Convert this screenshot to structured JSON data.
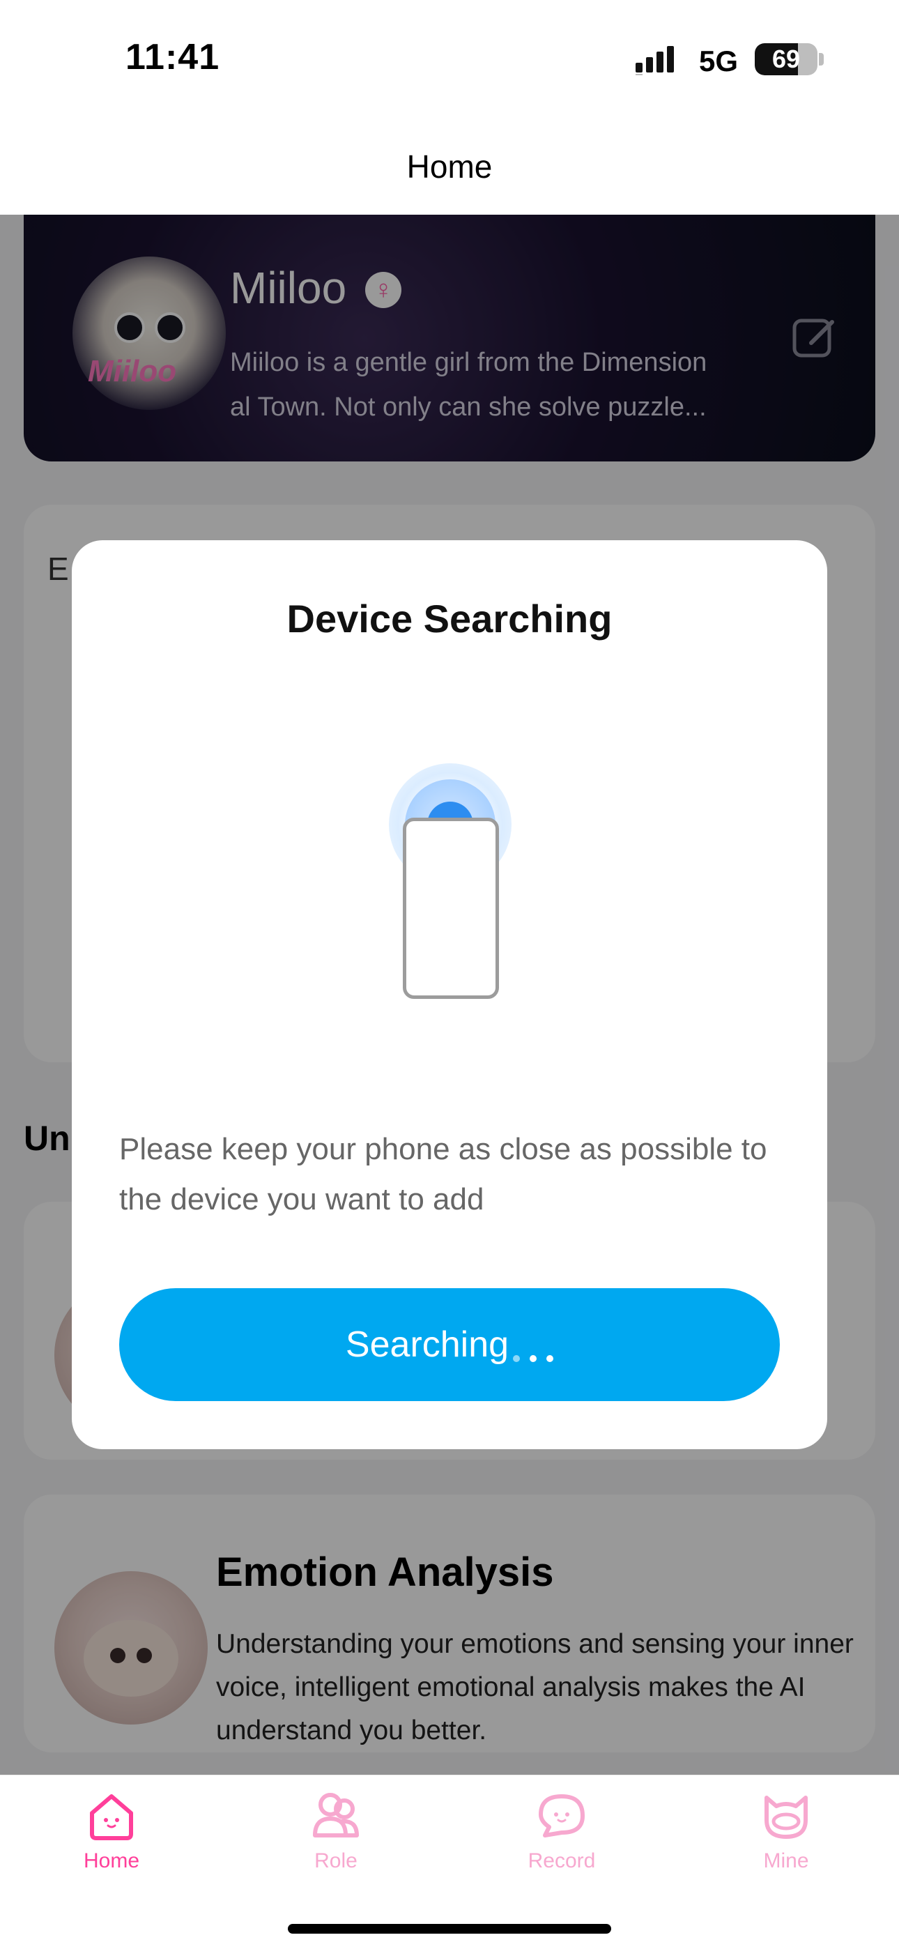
{
  "status_bar": {
    "time": "11:41",
    "network": "5G",
    "battery": "69",
    "battery_fraction": 0.69
  },
  "nav": {
    "title": "Home"
  },
  "role_card": {
    "name": "Miiloo",
    "logo_text": "Miiloo",
    "description_line1": "Miiloo is a gentle girl from the Dimension",
    "description_line2": "al Town. Not only can she solve puzzle..."
  },
  "device_card": {
    "title_peek": "E"
  },
  "section": {
    "title": "Un"
  },
  "features": [
    {
      "title": "",
      "description": ""
    },
    {
      "title": "Emotion Analysis",
      "description": "Understanding your emotions and sensing your inner voice, intelligent emotional analysis makes the AI understand you better."
    }
  ],
  "modal": {
    "title": "Device Searching",
    "tip": "Please keep your phone as close as possible to the device you want to add",
    "button_label": "Searching"
  },
  "tabs": [
    {
      "label": "Home",
      "icon": "home-icon",
      "active": true
    },
    {
      "label": "Role",
      "icon": "role-icon",
      "active": false
    },
    {
      "label": "Record",
      "icon": "record-icon",
      "active": false
    },
    {
      "label": "Mine",
      "icon": "mine-icon",
      "active": false
    }
  ],
  "colors": {
    "accent_blue": "#00a8f0",
    "tab_active": "#ff3f9a",
    "tab_inactive": "#f7a8cf"
  }
}
